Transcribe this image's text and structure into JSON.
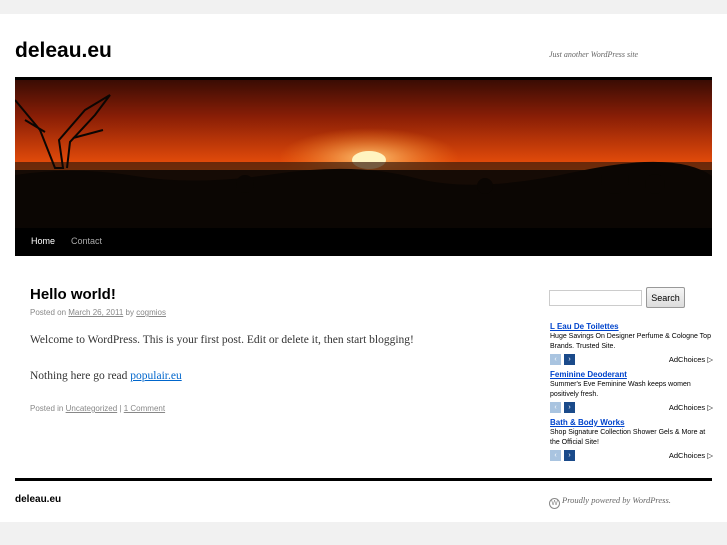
{
  "site": {
    "title": "deleau.eu",
    "description": "Just another WordPress site"
  },
  "menu": {
    "items": [
      {
        "label": "Home",
        "current": true
      },
      {
        "label": "Contact",
        "current": false
      }
    ]
  },
  "post": {
    "title": "Hello world!",
    "meta": {
      "posted_on": "Posted on",
      "date": "March 26, 2011",
      "by": "by",
      "author": "cogmios"
    },
    "paragraphs": {
      "p1": "Welcome to WordPress. This is your first post. Edit or delete it, then start blogging!",
      "p2_text": "Nothing here go read ",
      "p2_link": "populair.eu"
    },
    "utility": {
      "posted_in": "Posted in",
      "category": "Uncategorized",
      "separator": "|",
      "comments": "1 Comment"
    }
  },
  "search": {
    "button_label": "Search",
    "value": ""
  },
  "ads": [
    {
      "title": "L Eau De Toilettes",
      "text": "Huge Savings On Designer Perfume & Cologne Top Brands. Trusted Site."
    },
    {
      "title": "Feminine Deoderant",
      "text": "Summer's Eve Feminine Wash keeps women positively fresh."
    },
    {
      "title": "Bath & Body Works",
      "text": "Shop Signature Collection Shower Gels & More at the Official Site!"
    }
  ],
  "ad_controls": {
    "prev_glyph": "‹",
    "next_glyph": "›",
    "adchoices_label": "AdChoices ▷"
  },
  "footer": {
    "site_title": "deleau.eu",
    "powered_by": "Proudly powered by WordPress.",
    "wp_glyph": "W"
  },
  "colors": {
    "link": "#0066cc",
    "ad_link": "#0044cc",
    "bar": "#000000"
  }
}
